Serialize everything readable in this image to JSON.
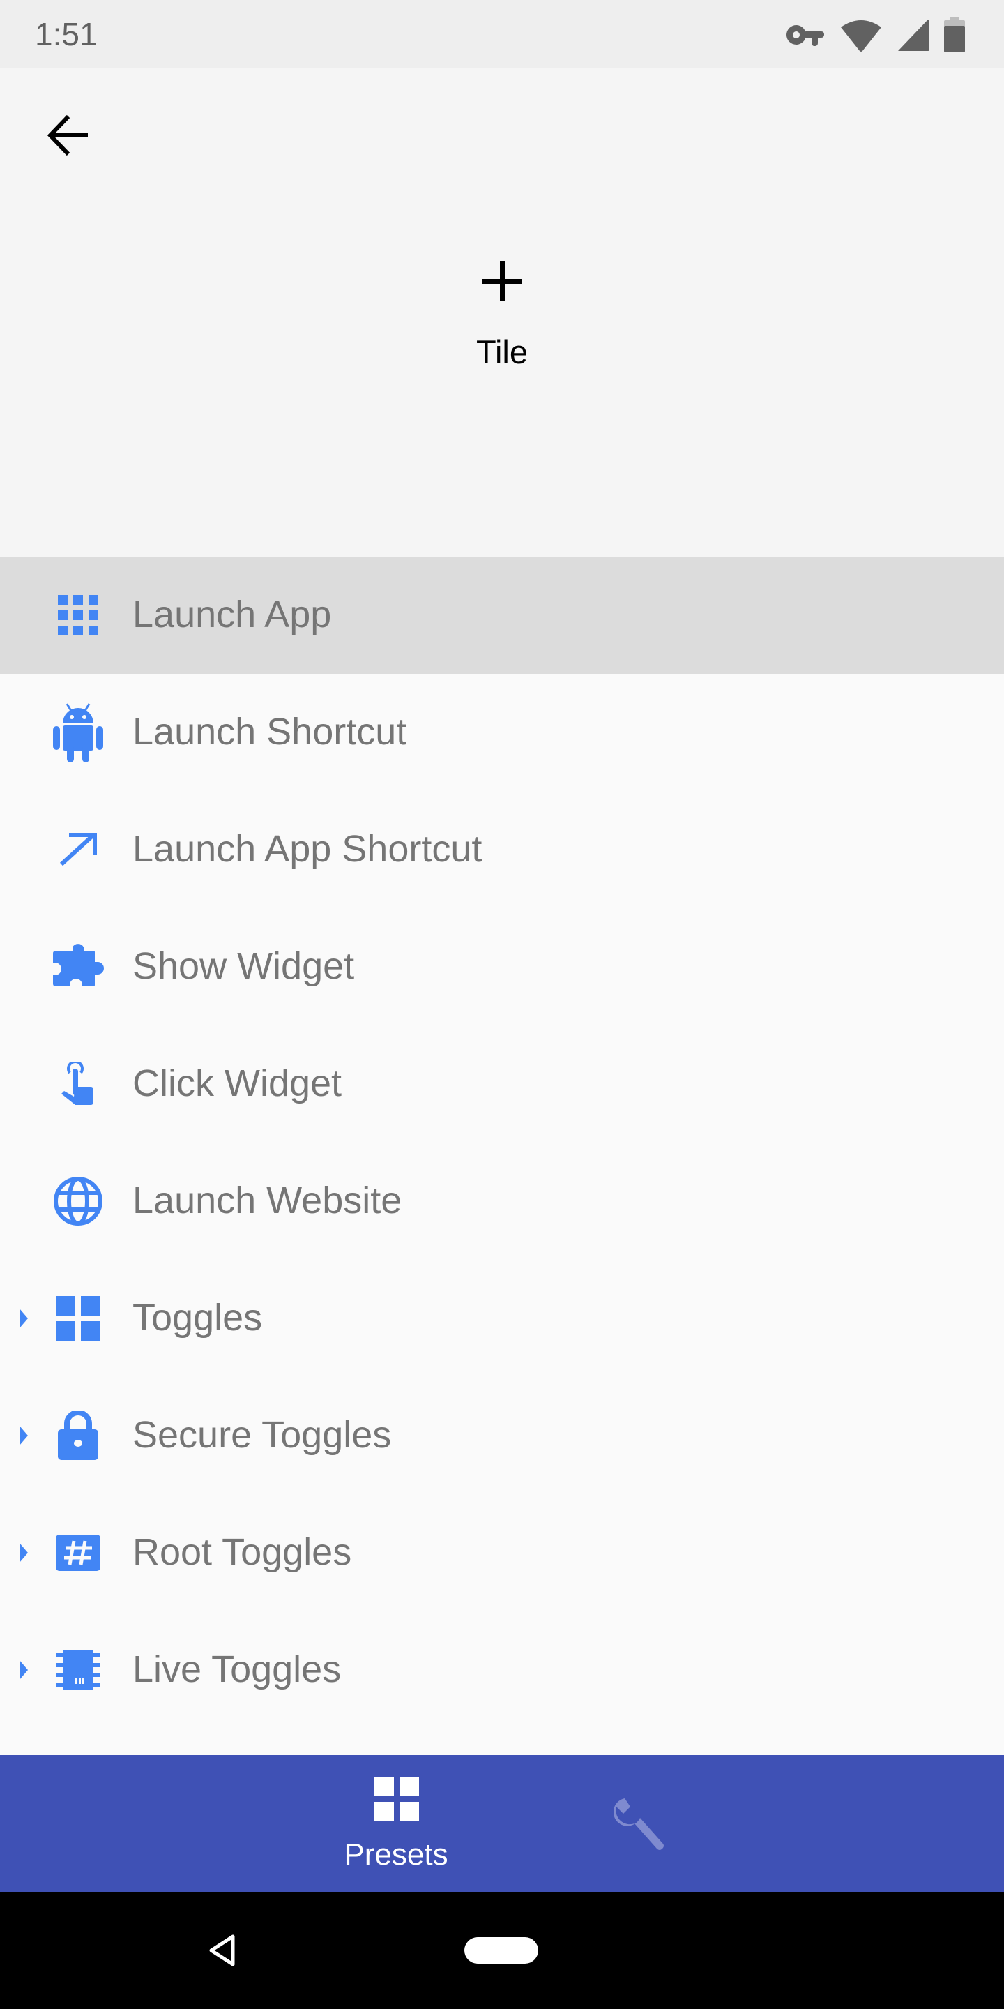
{
  "status_bar": {
    "time": "1:51",
    "icons": [
      "vpn-key-icon",
      "wifi-icon",
      "cell-signal-icon",
      "battery-icon"
    ]
  },
  "header": {
    "back_icon": "arrow-back-icon",
    "add_icon": "plus-icon",
    "tile_label": "Tile"
  },
  "colors": {
    "accent": "#4285f4",
    "bottom_nav": "#3f51b5",
    "selected_row": "#dcdcdc",
    "label_text": "#757575"
  },
  "list": {
    "items": [
      {
        "label": "Launch App",
        "icon": "apps-grid-icon",
        "selected": true,
        "expandable": false
      },
      {
        "label": "Launch Shortcut",
        "icon": "android-icon",
        "selected": false,
        "expandable": false
      },
      {
        "label": "Launch App Shortcut",
        "icon": "arrow-up-right-icon",
        "selected": false,
        "expandable": false
      },
      {
        "label": "Show Widget",
        "icon": "puzzle-piece-icon",
        "selected": false,
        "expandable": false
      },
      {
        "label": "Click Widget",
        "icon": "touch-tap-icon",
        "selected": false,
        "expandable": false
      },
      {
        "label": "Launch Website",
        "icon": "globe-icon",
        "selected": false,
        "expandable": false
      },
      {
        "label": "Toggles",
        "icon": "four-squares-icon",
        "selected": false,
        "expandable": true
      },
      {
        "label": "Secure Toggles",
        "icon": "lock-icon",
        "selected": false,
        "expandable": true
      },
      {
        "label": "Root Toggles",
        "icon": "hash-box-icon",
        "selected": false,
        "expandable": true
      },
      {
        "label": "Live Toggles",
        "icon": "chip-icon",
        "selected": false,
        "expandable": true
      }
    ]
  },
  "bottom_nav": {
    "items": [
      {
        "label": "Presets",
        "icon": "presets-grid-icon",
        "active": true
      },
      {
        "label": "",
        "icon": "wrench-icon",
        "active": false
      }
    ]
  },
  "system_nav": {
    "back_icon": "nav-back-icon",
    "home_icon": "nav-home-pill-icon"
  }
}
